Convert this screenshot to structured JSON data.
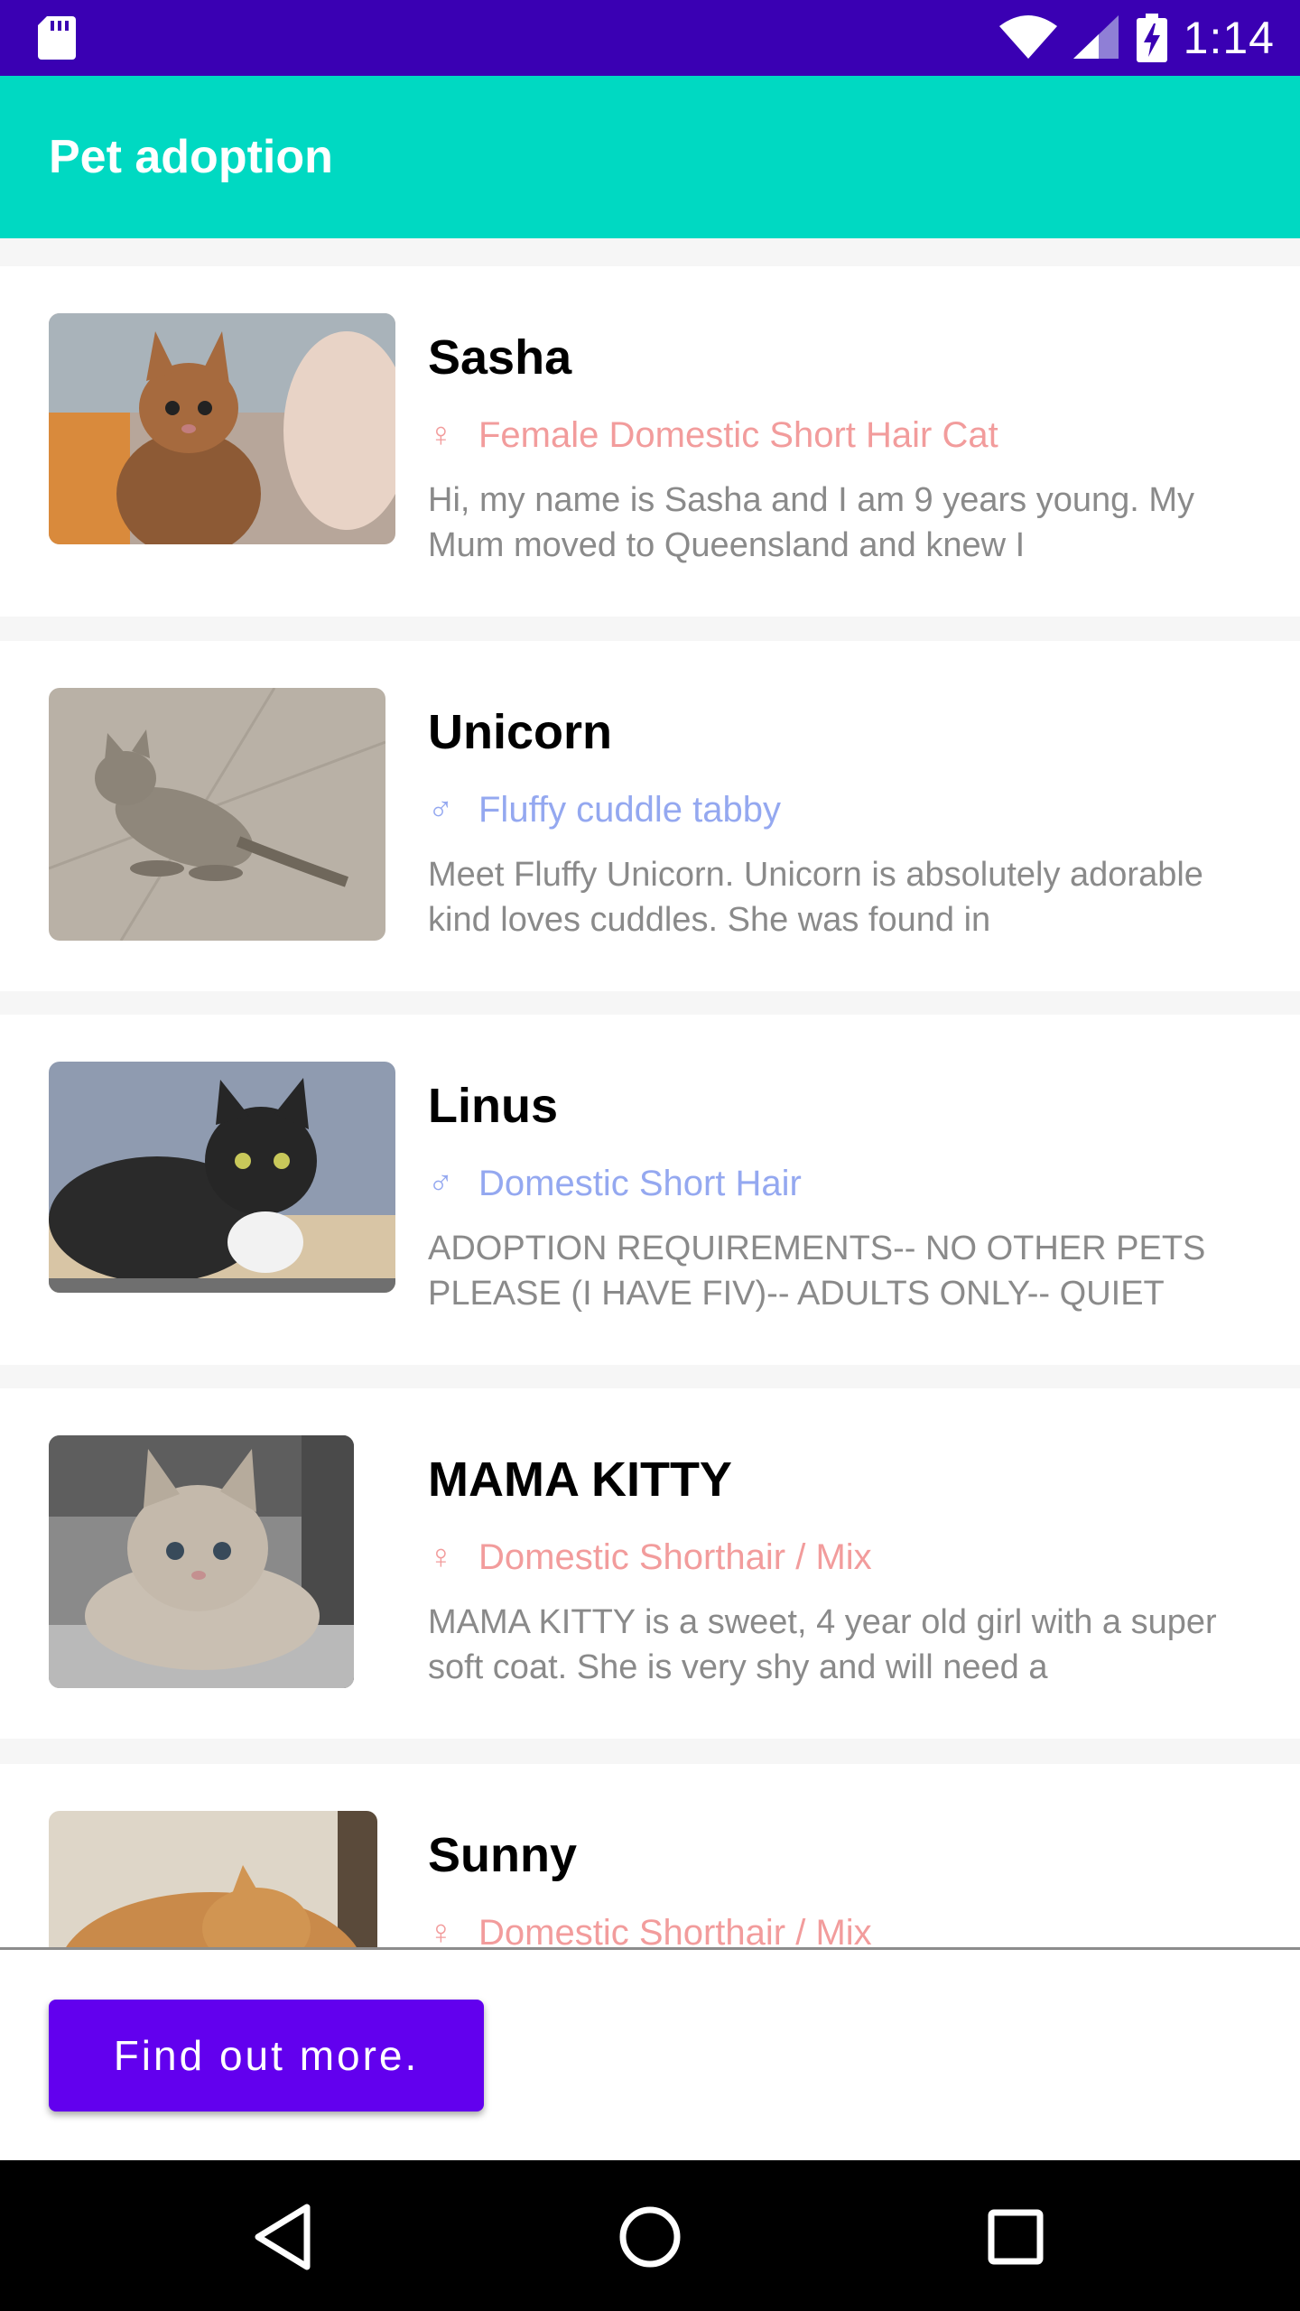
{
  "status_bar": {
    "time": "1:14"
  },
  "app_bar": {
    "title": "Pet adoption"
  },
  "pets": [
    {
      "name": "Sasha",
      "gender": "female",
      "gender_symbol": "♀",
      "breed": "Female Domestic Short Hair Cat",
      "description": "Hi, my name is Sasha and I am 9 years young. My Mum moved to Queensland and knew I"
    },
    {
      "name": "Unicorn",
      "gender": "male",
      "gender_symbol": "♂",
      "breed": "Fluffy cuddle tabby",
      "description": "Meet Fluffy Unicorn. Unicorn is absolutely adorable kind loves cuddles. She was found in"
    },
    {
      "name": "Linus",
      "gender": "male",
      "gender_symbol": "♂",
      "breed": "Domestic Short Hair",
      "description": "ADOPTION REQUIREMENTS-- NO OTHER PETS PLEASE (I HAVE FIV)-- ADULTS ONLY-- QUIET"
    },
    {
      "name": "MAMA KITTY",
      "gender": "female",
      "gender_symbol": "♀",
      "breed": "Domestic Shorthair / Mix",
      "description": "MAMA KITTY is a sweet, 4 year old girl with a super soft coat. She is very shy and will need a"
    },
    {
      "name": "Sunny",
      "gender": "female",
      "gender_symbol": "♀",
      "breed": "Domestic Shorthair / Mix",
      "description": ""
    }
  ],
  "action": {
    "button_label": "Find out more."
  },
  "colors": {
    "status_bar": "#3a00b3",
    "app_bar": "#00d9c2",
    "button": "#6200ee",
    "female": "#f29c9c",
    "male": "#94a8f0"
  }
}
